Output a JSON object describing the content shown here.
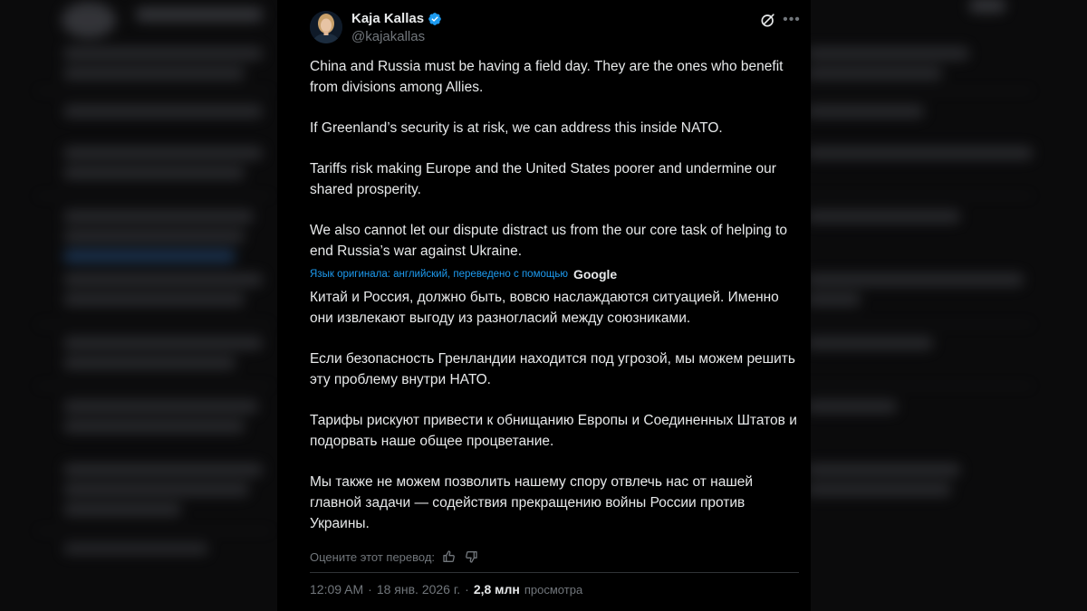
{
  "tweet": {
    "author_name": "Kaja Kallas",
    "handle": "@kajakallas",
    "original_paragraphs": [
      "China and Russia must be having a field day. They are the ones who benefit from divisions among Allies.",
      "If Greenland’s security is at risk, we can address this inside NATO.",
      "Tariffs risk making Europe and the United States poorer and undermine our shared prosperity.",
      "We also cannot let our dispute distract us from the our core task of helping to end Russia’s war against Ukraine."
    ],
    "translation_note": "Язык оригинала: английский, переведено с помощью",
    "translation_provider": "Google",
    "translated_paragraphs": [
      "Китай и Россия, должно быть, вовсю наслаждаются ситуацией. Именно они извлекают выгоду из разногласий между союзниками.",
      "Если безопасность Гренландии находится под угрозой, мы можем решить эту проблему внутри НАТО.",
      "Тарифы рискуют привести к обнищанию Европы и Соединенных Штатов и подорвать наше общее процветание.",
      "Мы также не можем позволить нашему спору отвлечь нас от нашей главной задачи — содействия прекращению войны России против Украины."
    ],
    "rate_translation_label": "Оцените этот перевод:",
    "time": "12:09 AM",
    "date": "18 янв. 2026 г.",
    "views_count": "2,8 млн",
    "views_label": "просмотра",
    "dot": "·"
  },
  "colors": {
    "background": "#000000",
    "text_primary": "#e7e9ea",
    "text_secondary": "#71767b",
    "link": "#1d9bf0",
    "verified": "#1d9bf0"
  }
}
